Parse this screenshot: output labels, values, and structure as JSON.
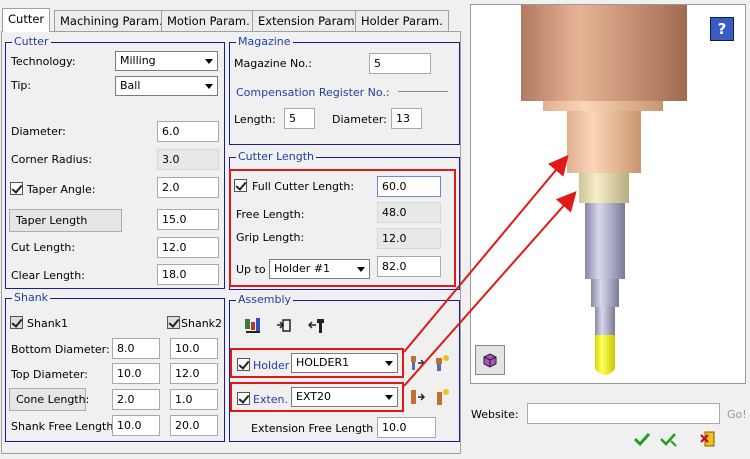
{
  "tabs": [
    "Cutter",
    "Machining Param.",
    "Motion Param.",
    "Extension Param.",
    "Holder Param."
  ],
  "cutter": {
    "title": "Cutter",
    "technology_label": "Technology:",
    "technology_value": "Milling",
    "tip_label": "Tip:",
    "tip_value": "Ball",
    "diameter_label": "Diameter:",
    "diameter_value": "6.0",
    "corner_radius_label": "Corner Radius:",
    "corner_radius_value": "3.0",
    "taper_angle_label": "Taper Angle:",
    "taper_angle_value": "2.0",
    "taper_length_button": "Taper Length",
    "taper_length_value": "15.0",
    "cut_length_label": "Cut Length:",
    "cut_length_value": "12.0",
    "clear_length_label": "Clear Length:",
    "clear_length_value": "18.0"
  },
  "magazine": {
    "title": "Magazine",
    "magazine_no_label": "Magazine No.:",
    "magazine_no_value": "5",
    "comp_reg_label": "Compensation Register No.:",
    "length_label": "Length:",
    "length_value": "5",
    "diameter_label": "Diameter:",
    "diameter_value": "13"
  },
  "cutter_length": {
    "title": "Cutter Length",
    "full_label": "Full Cutter Length:",
    "full_value": "60.0",
    "free_label": "Free Length:",
    "free_value": "48.0",
    "grip_label": "Grip Length:",
    "grip_value": "12.0",
    "upto_label": "Up to",
    "upto_select": "Holder #1",
    "upto_value": "82.0"
  },
  "shank": {
    "title": "Shank",
    "shank1_label": "Shank1",
    "shank2_label": "Shank2",
    "bottom_diameter_label": "Bottom Diameter:",
    "bottom_diameter_1": "8.0",
    "bottom_diameter_2": "10.0",
    "top_diameter_label": "Top Diameter:",
    "top_diameter_1": "10.0",
    "top_diameter_2": "12.0",
    "cone_length_button": "Cone Length:",
    "cone_length_1": "2.0",
    "cone_length_2": "1.0",
    "free_length_label": "Shank Free Length:",
    "free_length_1": "10.0",
    "free_length_2": "20.0"
  },
  "assembly": {
    "title": "Assembly",
    "holder_label": "Holder",
    "holder_value": "HOLDER1",
    "extension_label": "Exten.",
    "extension_value": "EXT20",
    "ext_free_label": "Extension Free Length",
    "ext_free_value": "10.0"
  },
  "footer": {
    "website_label": "Website:",
    "go_label": "Go!"
  },
  "colors": {
    "group_border": "#1a1aa0",
    "group_title": "#1f3fa8",
    "annotation": "#e01818",
    "holder_top": "#d9a48a",
    "holder_mid": "#f5c9a8",
    "extension": "#ece0b0",
    "shank": "#a8a8c8",
    "tip": "#f0f020"
  }
}
